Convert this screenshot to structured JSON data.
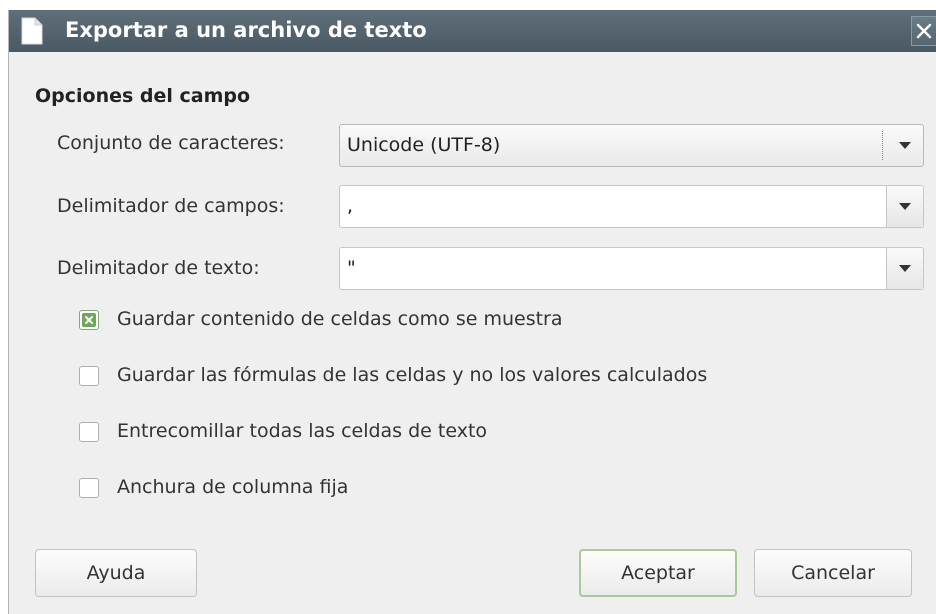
{
  "window": {
    "title": "Exportar a un archivo de texto"
  },
  "section": {
    "title": "Opciones del campo"
  },
  "fields": {
    "charset": {
      "label": "Conjunto de caracteres:",
      "value": "Unicode (UTF-8)"
    },
    "field_delimiter": {
      "label": "Delimitador de campos:",
      "value": ","
    },
    "text_delimiter": {
      "label": "Delimitador de texto:",
      "value": "\""
    }
  },
  "options": [
    {
      "label": "Guardar contenido de celdas como se muestra",
      "checked": true
    },
    {
      "label": "Guardar las fórmulas de las celdas y no los valores calculados",
      "checked": false
    },
    {
      "label": "Entrecomillar todas las celdas de texto",
      "checked": false
    },
    {
      "label": "Anchura de columna fija",
      "checked": false
    }
  ],
  "buttons": {
    "help": "Ayuda",
    "ok": "Aceptar",
    "cancel": "Cancelar"
  },
  "colors": {
    "titlebar": "#4f5f6a",
    "check_accent": "#6da85a"
  },
  "icons": {
    "title": "document-icon",
    "close": "close-icon",
    "dropdown": "chevron-down-icon",
    "check": "checkmark-icon"
  }
}
